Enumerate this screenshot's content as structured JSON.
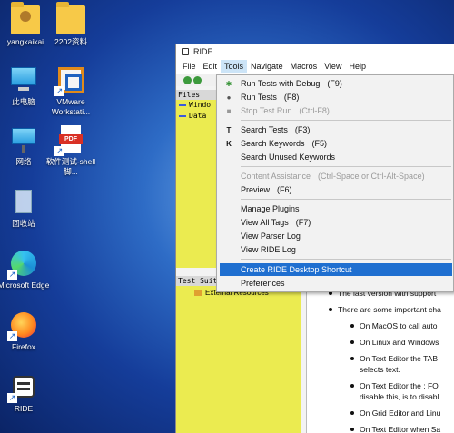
{
  "desktop": {
    "icons": [
      {
        "label": "yangkaikai",
        "icon": "user-folder-icon"
      },
      {
        "label": "2202资料",
        "icon": "folder-icon"
      },
      {
        "label": "此电脑",
        "icon": "computer-icon"
      },
      {
        "label": "VMware Workstati...",
        "icon": "vmware-icon"
      },
      {
        "label": "网络",
        "icon": "network-icon"
      },
      {
        "label": "软件测试-shell脚...",
        "icon": "pdf-icon"
      },
      {
        "label": "回收站",
        "icon": "recycle-bin-icon"
      },
      {
        "label": "Microsoft Edge",
        "icon": "edge-icon"
      },
      {
        "label": "Firefox",
        "icon": "firefox-icon"
      },
      {
        "label": "RIDE",
        "icon": "ride-icon"
      }
    ]
  },
  "window": {
    "title": "RIDE",
    "menus": [
      "File",
      "Edit",
      "Tools",
      "Navigate",
      "Macros",
      "View",
      "Help"
    ],
    "files_panel": {
      "header": "Files",
      "items": [
        "Windo",
        "Data"
      ]
    },
    "test_panel": {
      "header": "Test Suites",
      "items": [
        "External Resources"
      ]
    }
  },
  "tools_menu": {
    "items": [
      {
        "label": "Run Tests with Debug",
        "accel": "(F9)",
        "icon": "bug-icon"
      },
      {
        "label": "Run Tests",
        "accel": "(F8)",
        "icon": "run-icon"
      },
      {
        "label": "Stop Test Run",
        "accel": "(Ctrl-F8)",
        "icon": "stop-icon"
      },
      {
        "label": "Search Tests",
        "accel": "(F3)",
        "icon": "search-tests-icon"
      },
      {
        "label": "Search Keywords",
        "accel": "(F5)",
        "icon": "search-keywords-icon"
      },
      {
        "label": "Search Unused Keywords",
        "accel": ""
      },
      {
        "label": "Content Assistance",
        "accel": "(Ctrl-Space or Ctrl-Alt-Space)"
      },
      {
        "label": "Preview",
        "accel": "(F6)"
      },
      {
        "label": "Manage Plugins",
        "accel": ""
      },
      {
        "label": "View All Tags",
        "accel": "(F7)"
      },
      {
        "label": "View Parser Log",
        "accel": ""
      },
      {
        "label": "View RIDE Log",
        "accel": ""
      },
      {
        "label": "Create RIDE Desktop Shortcut",
        "accel": ""
      },
      {
        "label": "Preferences",
        "accel": ""
      }
    ]
  },
  "release_notes": {
    "lines": [
      "The last version with support f",
      "There are some important cha",
      "On MacOS to call auto",
      "On Linux and Windows",
      "On Text Editor the TAB",
      "selects text.",
      "On Text Editor the : FO",
      "disable this, is to disabl",
      "On Grid Editor and Linu",
      "On Text Editor when Sa"
    ]
  },
  "colors": {
    "highlight": "#1f6fd0",
    "panel_yellow": "#ebeb50",
    "desktop_blue": "#2e6cc6"
  }
}
